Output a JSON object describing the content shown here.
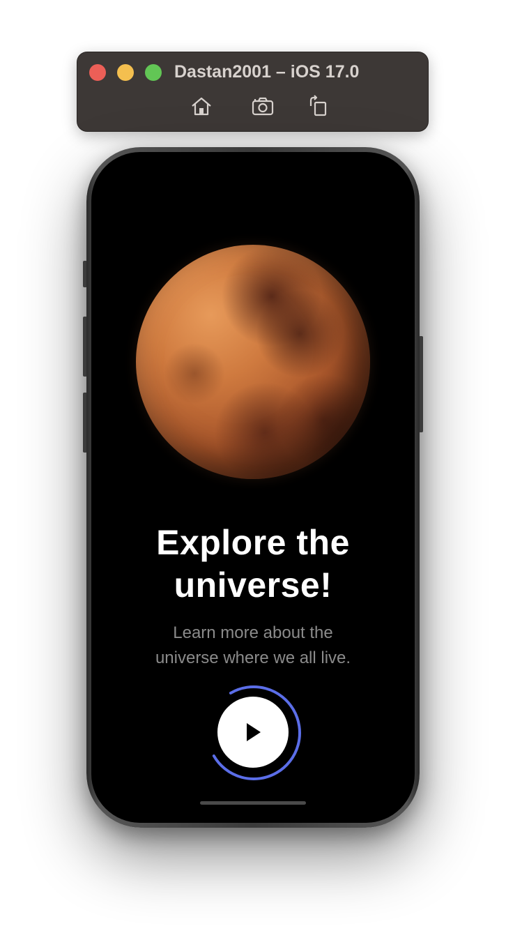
{
  "simulator": {
    "title": "Dastan2001 – iOS 17.0",
    "toolbar": {
      "home_icon": "home-icon",
      "screenshot_icon": "camera-icon",
      "rotate_icon": "rotate-icon"
    },
    "traffic_lights": {
      "close_color": "#ec5f57",
      "minimize_color": "#f4bf4f",
      "zoom_color": "#62c655"
    }
  },
  "app": {
    "background_color": "#000000",
    "planet_icon": "mars-planet-image",
    "headline": {
      "line1": "Explore the",
      "line2": "universe!"
    },
    "subtitle": {
      "line1": "Learn more about the",
      "line2": "universe where we all live."
    },
    "play_button": {
      "icon": "play-icon",
      "ring_color": "#5b6ee8",
      "progress": 0.75
    }
  }
}
